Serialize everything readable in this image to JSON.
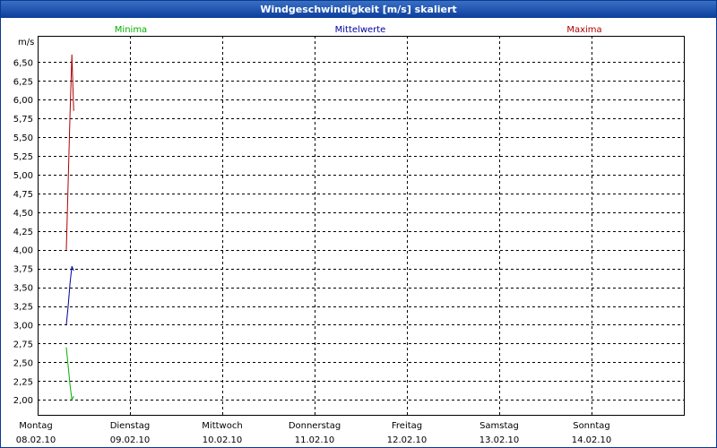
{
  "window": {
    "title": "Windgeschwindigkeit [m/s] skaliert"
  },
  "colors": {
    "minima": "#00b000",
    "mittelwerte": "#0000a0",
    "maxima": "#b00000",
    "title_bar": "#0b3e9b",
    "grid": "#000000"
  },
  "chart_data": {
    "type": "line",
    "title": "Windgeschwindigkeit [m/s] skaliert",
    "ylabel": "m/s",
    "xlabel": "",
    "ylim": [
      1.8,
      6.85
    ],
    "grid": true,
    "legend_position": "top",
    "y_ticks": [
      "6,50",
      "6,25",
      "6,00",
      "5,75",
      "5,50",
      "5,25",
      "5,00",
      "4,75",
      "4,50",
      "4,25",
      "4,00",
      "3,75",
      "3,50",
      "3,25",
      "3,00",
      "2,75",
      "2,50",
      "2,25",
      "2,00"
    ],
    "y_tick_values": [
      6.5,
      6.25,
      6.0,
      5.75,
      5.5,
      5.25,
      5.0,
      4.75,
      4.5,
      4.25,
      4.0,
      3.75,
      3.5,
      3.25,
      3.0,
      2.75,
      2.5,
      2.25,
      2.0
    ],
    "x_range": [
      0,
      7
    ],
    "days": [
      {
        "day": "Montag",
        "date": "08.02.10"
      },
      {
        "day": "Dienstag",
        "date": "09.02.10"
      },
      {
        "day": "Mittwoch",
        "date": "10.02.10"
      },
      {
        "day": "Donnerstag",
        "date": "11.02.10"
      },
      {
        "day": "Freitag",
        "date": "12.02.10"
      },
      {
        "day": "Samstag",
        "date": "13.02.10"
      },
      {
        "day": "Sonntag",
        "date": "14.02.10"
      }
    ],
    "series": [
      {
        "name": "Minima",
        "color": "#00b000",
        "x": [
          0.0,
          0.02,
          0.04,
          0.06,
          0.08
        ],
        "y": [
          2.7,
          2.45,
          2.2,
          2.0,
          2.05
        ]
      },
      {
        "name": "Mittelwerte",
        "color": "#0000a0",
        "x": [
          0.0,
          0.02,
          0.04,
          0.06,
          0.08
        ],
        "y": [
          3.0,
          3.25,
          3.55,
          3.78,
          3.72
        ]
      },
      {
        "name": "Maxima",
        "color": "#b00000",
        "x": [
          0.0,
          0.02,
          0.04,
          0.06,
          0.08
        ],
        "y": [
          4.0,
          4.9,
          5.8,
          6.6,
          5.85
        ]
      }
    ]
  }
}
